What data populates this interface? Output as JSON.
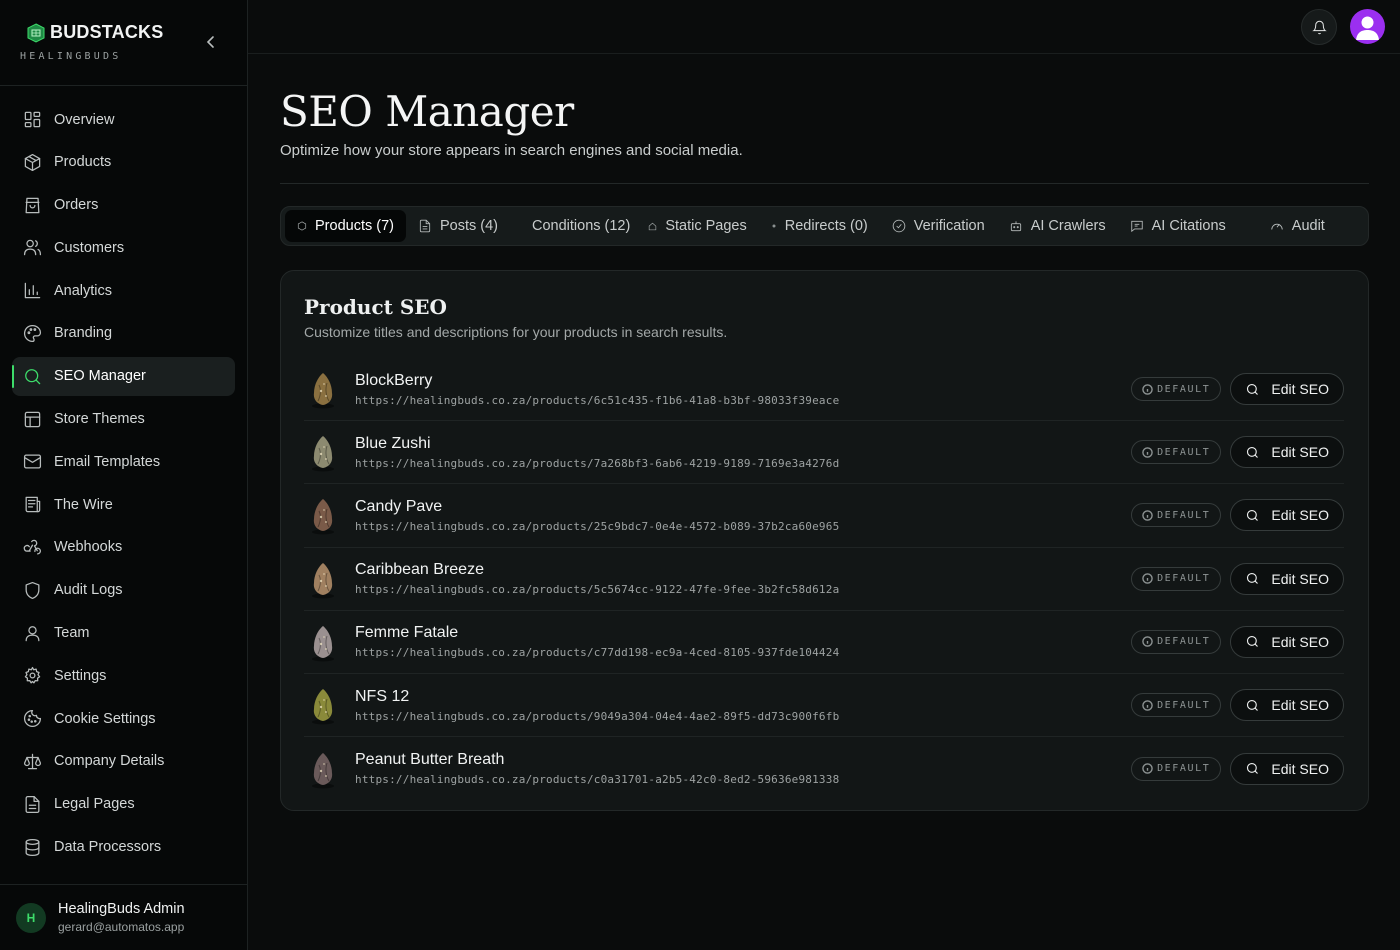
{
  "brand": {
    "name": "BUDSTACKS",
    "subtitle": "HEALINGBUDS",
    "accent": "#3ddc6a"
  },
  "sidebar": {
    "items": [
      {
        "label": "Overview",
        "icon": "dashboard-icon"
      },
      {
        "label": "Products",
        "icon": "box-icon"
      },
      {
        "label": "Orders",
        "icon": "shopping-bag-icon"
      },
      {
        "label": "Customers",
        "icon": "users-icon"
      },
      {
        "label": "Analytics",
        "icon": "bar-chart-icon"
      },
      {
        "label": "Branding",
        "icon": "palette-icon"
      },
      {
        "label": "SEO Manager",
        "icon": "search-icon",
        "active": true
      },
      {
        "label": "Store Themes",
        "icon": "layout-icon"
      },
      {
        "label": "Email Templates",
        "icon": "mail-icon"
      },
      {
        "label": "The Wire",
        "icon": "newspaper-icon"
      },
      {
        "label": "Webhooks",
        "icon": "webhook-icon"
      },
      {
        "label": "Audit Logs",
        "icon": "shield-icon"
      },
      {
        "label": "Team",
        "icon": "user-icon"
      },
      {
        "label": "Settings",
        "icon": "gear-icon"
      },
      {
        "label": "Cookie Settings",
        "icon": "cookie-icon"
      },
      {
        "label": "Company Details",
        "icon": "scale-icon"
      },
      {
        "label": "Legal Pages",
        "icon": "file-text-icon"
      },
      {
        "label": "Data Processors",
        "icon": "database-icon"
      }
    ]
  },
  "user": {
    "initial": "H",
    "name": "HealingBuds Admin",
    "email": "gerard@automatos.app"
  },
  "page": {
    "title": "SEO Manager",
    "subtitle": "Optimize how your store appears in search engines and social media."
  },
  "tabs": [
    {
      "label": "Products (7)",
      "icon": "box-icon",
      "active": true
    },
    {
      "label": "Posts (4)",
      "icon": "file-text-icon"
    },
    {
      "label": "Conditions (12)",
      "icon": ""
    },
    {
      "label": "Static Pages",
      "icon": "home-icon"
    },
    {
      "label": "Redirects (0)",
      "icon": "dot-icon"
    },
    {
      "label": "Verification",
      "icon": "check-circle-icon"
    },
    {
      "label": "AI Crawlers",
      "icon": "bot-icon"
    },
    {
      "label": "AI Citations",
      "icon": "message-icon"
    },
    {
      "label": "Audit",
      "icon": "gauge-icon"
    }
  ],
  "card": {
    "title": "Product SEO",
    "subtitle": "Customize titles and descriptions for your products in search results."
  },
  "products": [
    {
      "name": "BlockBerry",
      "url": "https://healingbuds.co.za/products/6c51c435-f1b6-41a8-b3bf-98033f39eace",
      "badge": "DEFAULT",
      "action": "Edit SEO",
      "color": "#8a7040"
    },
    {
      "name": "Blue Zushi",
      "url": "https://healingbuds.co.za/products/7a268bf3-6ab6-4219-9189-7169e3a4276d",
      "badge": "DEFAULT",
      "action": "Edit SEO",
      "color": "#8c8a70"
    },
    {
      "name": "Candy Pave",
      "url": "https://healingbuds.co.za/products/25c9bdc7-0e4e-4572-b089-37b2ca60e965",
      "badge": "DEFAULT",
      "action": "Edit SEO",
      "color": "#7a5a48"
    },
    {
      "name": "Caribbean Breeze",
      "url": "https://healingbuds.co.za/products/5c5674cc-9122-47fe-9fee-3b2fc58d612a",
      "badge": "DEFAULT",
      "action": "Edit SEO",
      "color": "#a08060"
    },
    {
      "name": "Femme Fatale",
      "url": "https://healingbuds.co.za/products/c77dd198-ec9a-4ced-8105-937fde104424",
      "badge": "DEFAULT",
      "action": "Edit SEO",
      "color": "#9a9090"
    },
    {
      "name": "NFS 12",
      "url": "https://healingbuds.co.za/products/9049a304-04e4-4ae2-89f5-dd73c900f6fb",
      "badge": "DEFAULT",
      "action": "Edit SEO",
      "color": "#8a8a3a"
    },
    {
      "name": "Peanut Butter Breath",
      "url": "https://healingbuds.co.za/products/c0a31701-a2b5-42c0-8ed2-59636e981338",
      "badge": "DEFAULT",
      "action": "Edit SEO",
      "color": "#6a5a5a"
    }
  ]
}
